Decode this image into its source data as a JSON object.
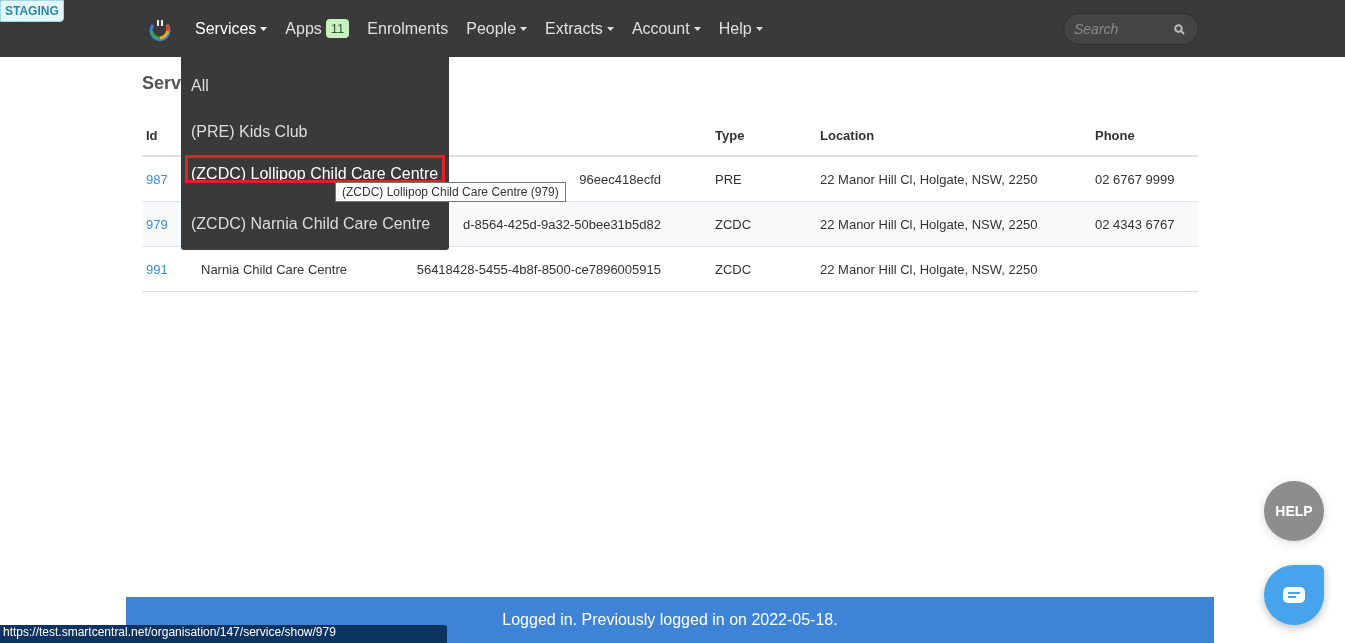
{
  "env_badge": "STAGING",
  "nav": {
    "items": [
      {
        "label": "Services",
        "dropdown": true,
        "selected": true
      },
      {
        "label": "Apps",
        "dropdown": false,
        "badge": "11",
        "selected": false
      },
      {
        "label": "Enrolments",
        "dropdown": false,
        "selected": false
      },
      {
        "label": "People",
        "dropdown": true,
        "selected": false
      },
      {
        "label": "Extracts",
        "dropdown": true,
        "selected": false
      },
      {
        "label": "Account",
        "dropdown": true,
        "selected": false
      },
      {
        "label": "Help",
        "dropdown": true,
        "selected": false
      }
    ],
    "search": {
      "placeholder": "Search"
    }
  },
  "menu": {
    "items": [
      {
        "label": "All",
        "selected": false
      },
      {
        "label": "(PRE) Kids Club",
        "selected": false
      },
      {
        "label": "(ZCDC) Lollipop Child Care Centre",
        "selected": true
      },
      {
        "label": "(ZCDC) Narnia Child Care Centre",
        "selected": false
      }
    ],
    "tooltip": "(ZCDC) Lollipop Child Care Centre (979)"
  },
  "page": {
    "title": "Serv"
  },
  "table": {
    "columns": {
      "id": "Id",
      "type": "Type",
      "location": "Location",
      "phone": "Phone"
    },
    "rows": [
      {
        "id": "987",
        "uid": "96eec418ecfd",
        "type": "PRE",
        "location": "22 Manor Hill Cl, Holgate, NSW, 2250",
        "phone": "02 6767 9999"
      },
      {
        "id": "979",
        "uid": "d-8564-425d-9a32-50bee31b5d82",
        "type": "ZCDC",
        "location": "22 Manor Hill Cl, Holgate, NSW, 2250",
        "phone": "02 4343 6767"
      },
      {
        "id": "991",
        "name": "Narnia Child Care Centre",
        "uid": "56418428-5455-4b8f-8500-ce7896005915",
        "type": "ZCDC",
        "location": "22 Manor Hill Cl, Holgate, NSW, 2250"
      }
    ]
  },
  "footer": "Logged in. Previously logged in on 2022-05-18.",
  "help_button": "HELP",
  "status_url": "https://test.smartcentral.net/organisation/147/service/show/979"
}
